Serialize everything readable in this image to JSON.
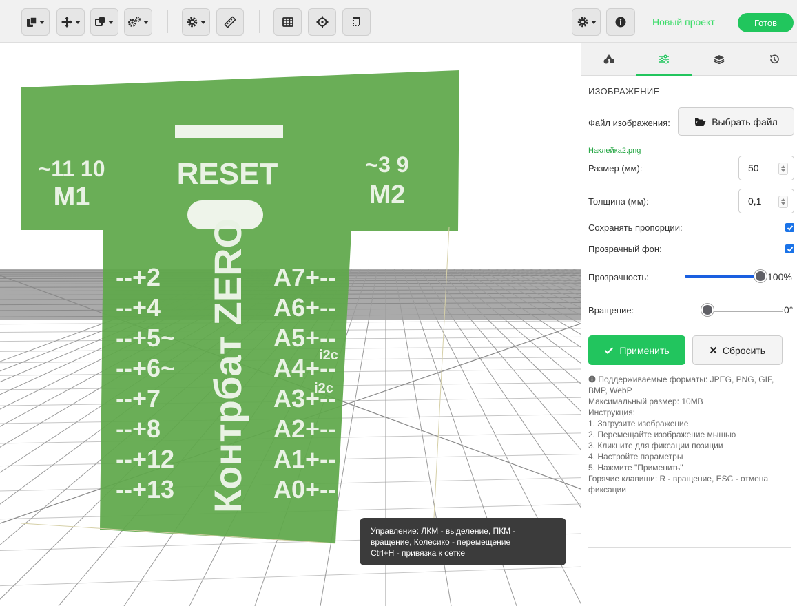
{
  "header": {
    "project_name": "Новый проект",
    "done_label": "Готов"
  },
  "toolbar_icons": [
    "clipboard-icon",
    "move-icon",
    "copy-icon",
    "gears-icon",
    "gear-icon",
    "ruler-icon",
    "grid-icon",
    "crosshair-icon",
    "crop-icon",
    "settings-icon",
    "info-icon"
  ],
  "viewport": {
    "decal_texts": {
      "top_left_a": "~11 10",
      "top_left_b": "M1",
      "top_right_a": "~3 9",
      "top_right_b": "M2",
      "reset": "RESET",
      "left_pins": [
        "--+2",
        "--+4",
        "--+5~",
        "--+6~",
        "--+7",
        "--+8",
        "--+12",
        "--+13"
      ],
      "right_pins": [
        "A7+--",
        "A6+--",
        "A5+--",
        "A4+--",
        "A3+--",
        "A2+--",
        "A1+--",
        "A0+--"
      ],
      "i2c_a": "i2c",
      "i2c_b": "i2c",
      "brand": "Контрбат ZERO"
    },
    "hint_lines": [
      "Управление: ЛКМ - выделение, ПКМ -",
      "вращение, Колесико - перемещение",
      "Ctrl+H - привязка к сетке"
    ]
  },
  "panel": {
    "tabs": [
      {
        "icon": "shapes-icon"
      },
      {
        "icon": "sliders-icon",
        "active": true
      },
      {
        "icon": "layers-icon"
      },
      {
        "icon": "history-icon"
      }
    ],
    "section_title": "ИЗОБРАЖЕНИЕ",
    "file_label": "Файл изображения:",
    "choose_file_label": "Выбрать файл",
    "file_name": "Наклейка2.png",
    "size_label": "Размер (мм):",
    "size_value": "50",
    "thickness_label": "Толщина (мм):",
    "thickness_value": "0,1",
    "keep_ratio_label": "Сохранять пропорции:",
    "keep_ratio_checked": true,
    "transparent_bg_label": "Прозрачный фон:",
    "transparent_bg_checked": true,
    "opacity_label": "Прозрачность:",
    "opacity_value": "100%",
    "opacity_fraction": 1.0,
    "rotation_label": "Вращение:",
    "rotation_value": "0°",
    "rotation_fraction": 0.0,
    "apply_label": "Применить",
    "reset_label": "Сбросить",
    "info_lines": [
      "Поддерживаемые форматы: JPEG, PNG, GIF, BMP, WebP",
      "Максимальный размер: 10MB",
      "Инструкция:",
      "1. Загрузите изображение",
      "2. Перемещайте изображение мышью",
      "3. Кликните для фиксации позиции",
      "4. Настройте параметры",
      "5. Нажмите \"Применить\"",
      "Горячие клавиши: R - вращение, ESC - отмена фиксации"
    ]
  },
  "colors": {
    "accent": "#22c55e",
    "decal": "#5fa84a",
    "checkbox": "#1a73e8",
    "slider_fill": "#1a5fe0"
  }
}
